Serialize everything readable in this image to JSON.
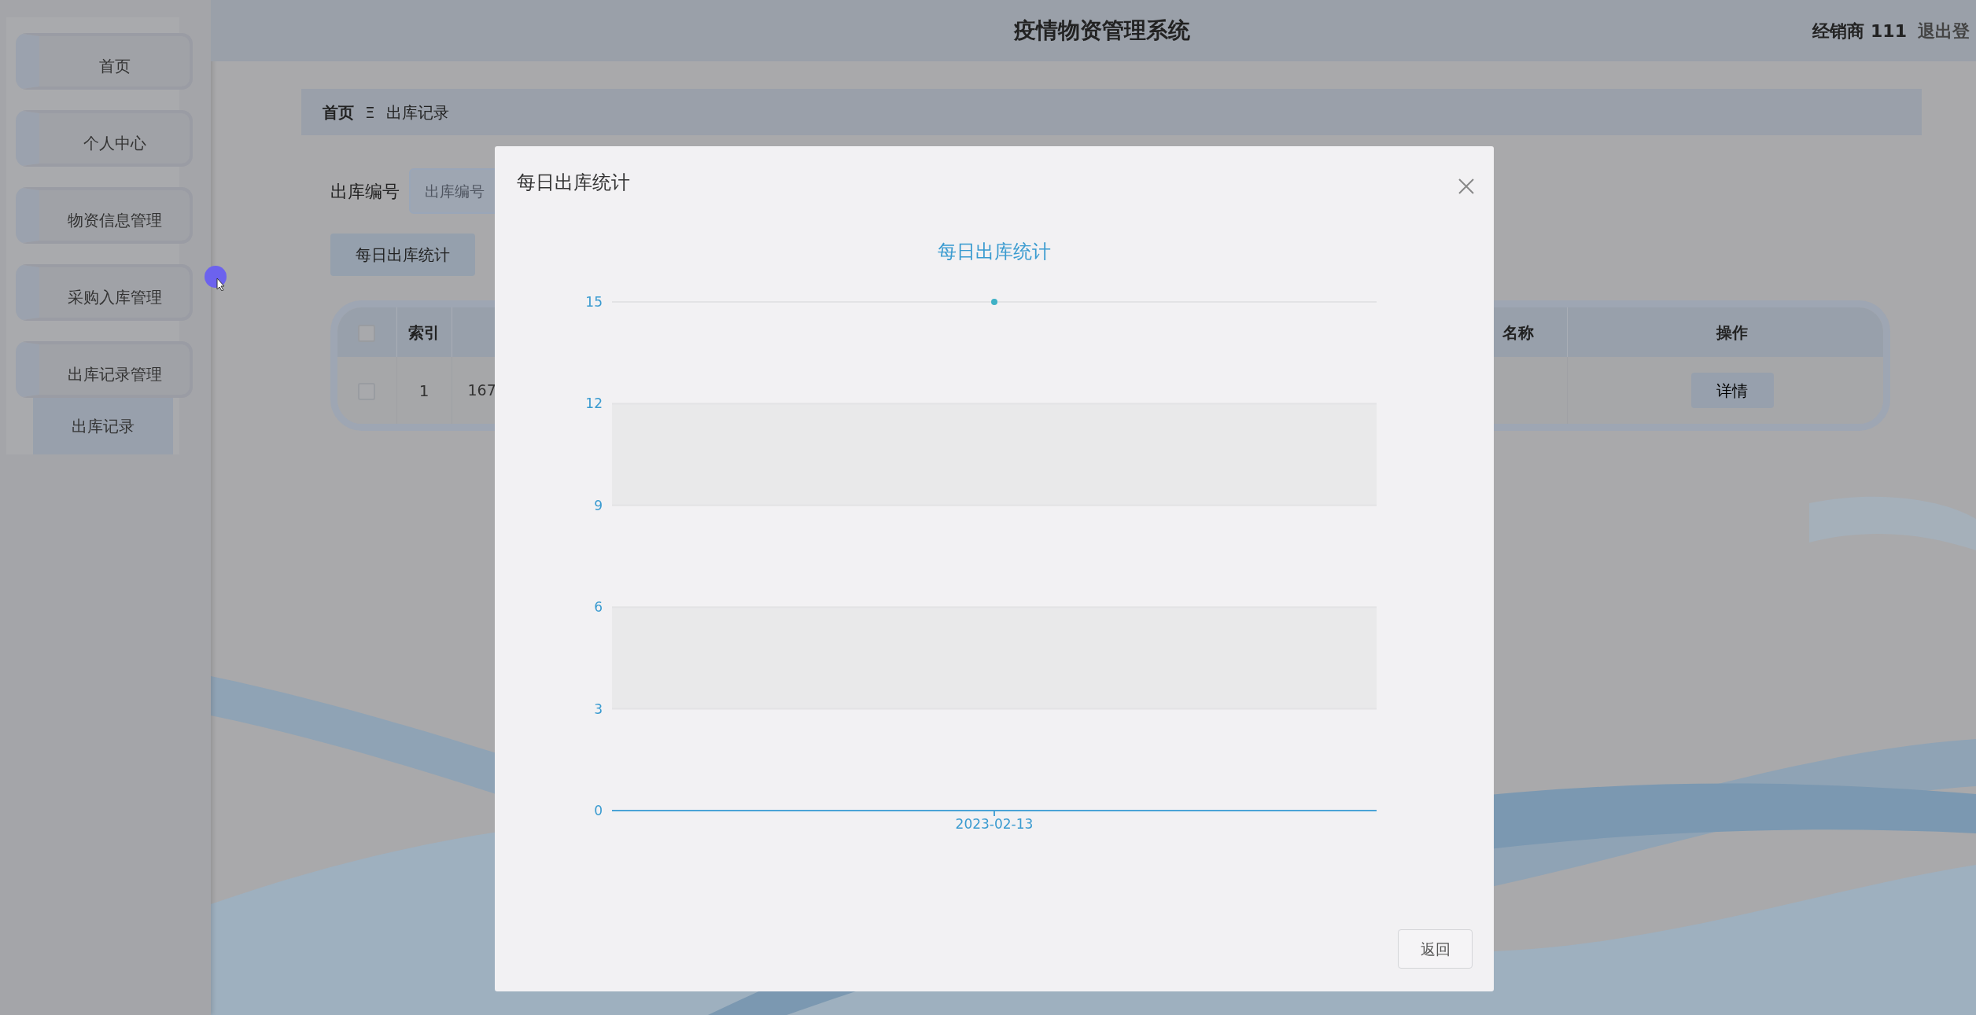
{
  "sidebar": {
    "items": [
      {
        "label": "首页"
      },
      {
        "label": "个人中心"
      },
      {
        "label": "物资信息管理"
      },
      {
        "label": "采购入库管理"
      },
      {
        "label": "出库记录管理",
        "children": [
          {
            "label": "出库记录",
            "selected": true
          }
        ]
      }
    ]
  },
  "header": {
    "title": "疫情物资管理系统",
    "user": "经销商 111",
    "logout": "退出登"
  },
  "breadcrumb": {
    "home": "首页",
    "separator": "Ξ",
    "current": "出库记录"
  },
  "search": {
    "fields": [
      {
        "label": "出库编号",
        "placeholder": "出库编号"
      }
    ]
  },
  "stats_button": "每日出库统计",
  "table": {
    "all_checked": false,
    "columns": [
      "索引",
      "名称",
      "操作"
    ],
    "rows": [
      {
        "checked": false,
        "cells": [
          "1",
          "167"
        ],
        "action": "详情"
      }
    ]
  },
  "modal": {
    "title": "每日出库统计",
    "button": "返回",
    "chart_data": {
      "type": "line",
      "title": "每日出库统计",
      "categories": [
        "2023-02-13"
      ],
      "grid": true,
      "series": [
        {
          "color": "#3fb1c6",
          "marker": true,
          "values": [
            15
          ]
        }
      ],
      "ylim": [
        0,
        15
      ],
      "yticks": [
        0,
        3,
        6,
        9,
        12,
        15
      ]
    }
  }
}
